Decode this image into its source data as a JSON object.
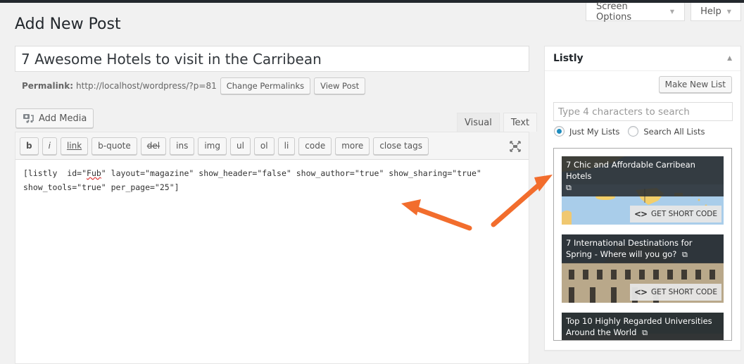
{
  "header": {
    "screen_options": "Screen Options",
    "help": "Help",
    "page_title": "Add New Post"
  },
  "post": {
    "title": "7 Awesome Hotels to visit in the Carribean",
    "permalink_label": "Permalink:",
    "permalink_url": "http://localhost/wordpress/?p=81",
    "change_permalinks": "Change Permalinks",
    "view_post": "View Post"
  },
  "editor": {
    "add_media": "Add Media",
    "tabs": [
      {
        "label": "Visual",
        "active": false
      },
      {
        "label": "Text",
        "active": true
      }
    ],
    "quicktags": [
      "b",
      "i",
      "link",
      "b-quote",
      "del",
      "ins",
      "img",
      "ul",
      "ol",
      "li",
      "code",
      "more",
      "close tags"
    ],
    "content_before_error": "[listly  id=\"",
    "content_error_word": "Fub",
    "content_after_error": "\" layout=\"magazine\" show_header=\"false\" show_author=\"true\" show_sharing=\"true\"\nshow_tools=\"true\" per_page=\"25\"]"
  },
  "listly": {
    "title": "Listly",
    "make_new_list": "Make New List",
    "search_placeholder": "Type 4 characters to search",
    "radio_options": [
      {
        "label": "Just My Lists",
        "checked": true
      },
      {
        "label": "Search All Lists",
        "checked": false
      }
    ],
    "get_short_code": "GET SHORT CODE",
    "lists": [
      {
        "title": "7 Chic and Affordable Carribean Hotels",
        "image": "caribbean-map"
      },
      {
        "title": "7 International Destinations for Spring - Where will you go?",
        "image": "louvre-building"
      },
      {
        "title": "Top 10 Highly Regarded Universities Around the World",
        "image": "university-campus"
      }
    ]
  },
  "annotations": {
    "arrow_color": "#f26d2d"
  }
}
